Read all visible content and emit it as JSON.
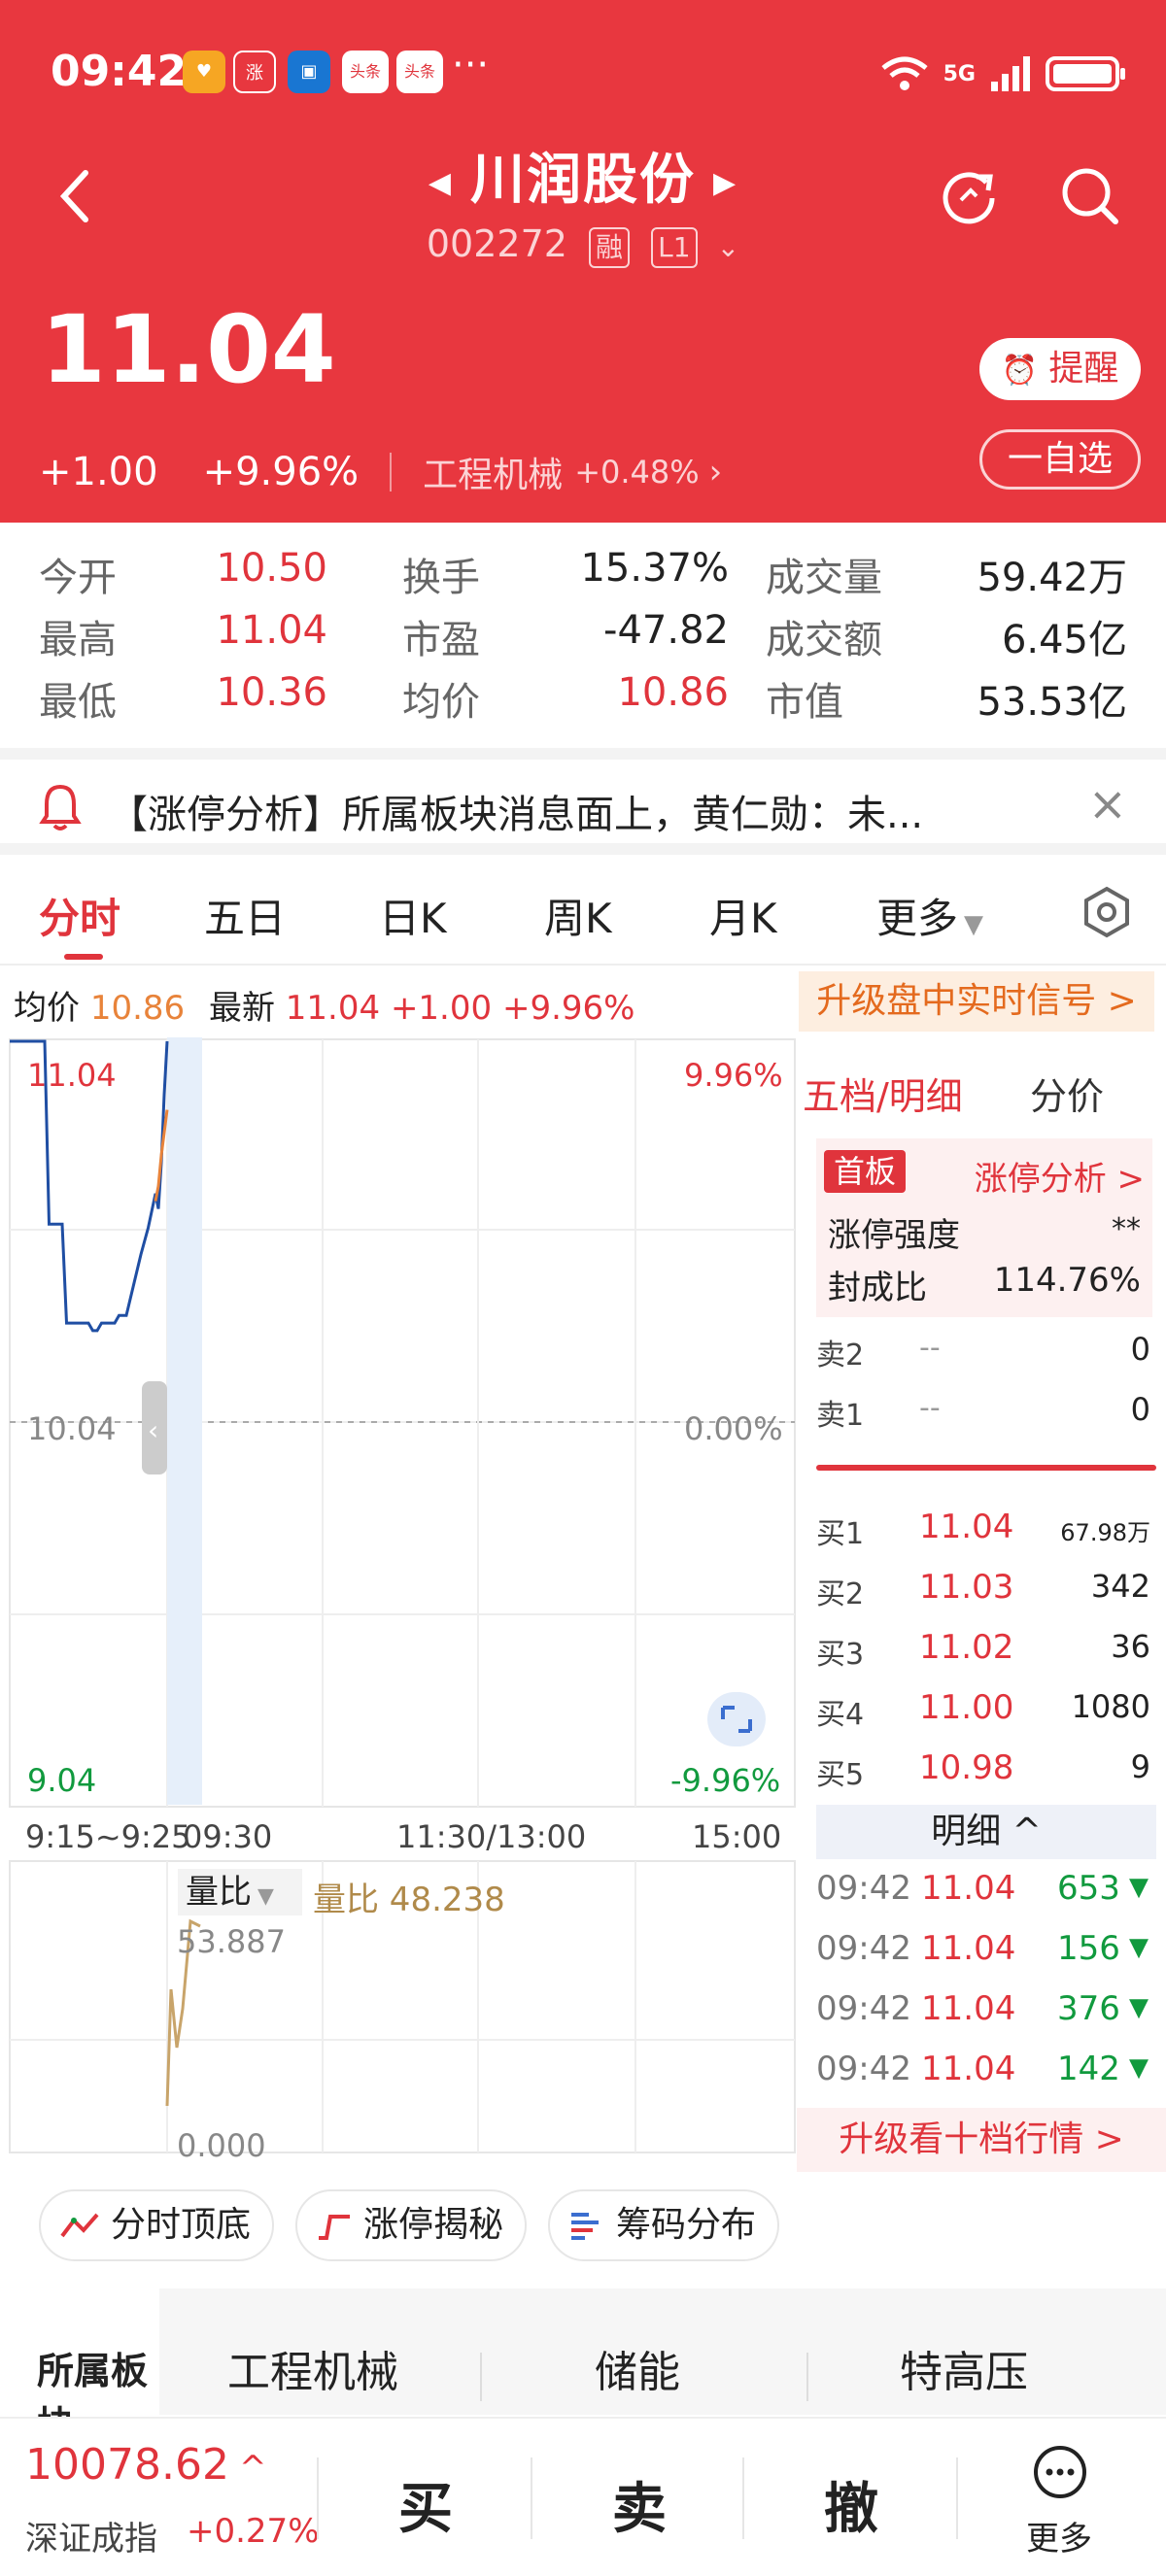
{
  "status_bar": {
    "time": "09:42",
    "net": "5G",
    "app_icons": [
      "涨",
      "",
      "头条",
      "头条"
    ],
    "more": "···"
  },
  "stock": {
    "name": "川润股份",
    "code": "002272",
    "tag_margin": "融",
    "tag_level": "L1",
    "price": "11.04",
    "change": "+1.00",
    "change_pct": "+9.96%",
    "sector": "工程机械",
    "sector_pct": "+0.48%",
    "alert_label": "提醒",
    "watch_label": "一自选"
  },
  "stats": [
    {
      "label": "今开",
      "value": "10.50",
      "color": "red"
    },
    {
      "label": "换手",
      "value": "15.37%",
      "color": "dark"
    },
    {
      "label": "成交量",
      "value": "59.42万",
      "color": "dark"
    },
    {
      "label": "最高",
      "value": "11.04",
      "color": "red"
    },
    {
      "label": "市盈",
      "value": "-47.82",
      "color": "dark"
    },
    {
      "label": "成交额",
      "value": "6.45亿",
      "color": "dark"
    },
    {
      "label": "最低",
      "value": "10.36",
      "color": "red"
    },
    {
      "label": "均价",
      "value": "10.86",
      "color": "red"
    },
    {
      "label": "市值",
      "value": "53.53亿",
      "color": "dark"
    }
  ],
  "notice": {
    "text": "【涨停分析】所属板块消息面上，黄仁勋：未...",
    "close": "×"
  },
  "tabs": [
    "分时",
    "五日",
    "日K",
    "周K",
    "月K",
    "更多"
  ],
  "chart_info": {
    "avg_label": "均价",
    "avg_value": "10.86",
    "latest_label": "最新",
    "latest_value": "11.04",
    "change": "+1.00",
    "pct": "+9.96%",
    "upgrade": "升级盘中实时信号 >"
  },
  "chart_axes": {
    "top_left": "11.04",
    "top_right": "9.96%",
    "mid_left": "10.04",
    "mid_right": "0.00%",
    "bottom_left": "9.04",
    "bottom_right": "-9.96%",
    "t1": "9:15~9:25",
    "t2": "09:30",
    "t3": "11:30/13:00",
    "t4": "15:00"
  },
  "chart_data": {
    "type": "line",
    "title": "",
    "ylim": [
      9.04,
      11.04
    ],
    "series": [
      {
        "name": "",
        "x": [
          0,
          3,
          6,
          9,
          12,
          15,
          18,
          21,
          24,
          27,
          30,
          33,
          36,
          39,
          42,
          45,
          48,
          51,
          54,
          57,
          60,
          63,
          66,
          69,
          72,
          75,
          80,
          85,
          90,
          95,
          100,
          102,
          104,
          106,
          108
        ],
        "y": [
          11.04,
          11.04,
          11.04,
          11.04,
          11.04,
          11.04,
          11.04,
          11.04,
          11.04,
          10.56,
          10.56,
          10.56,
          10.56,
          10.3,
          10.3,
          10.3,
          10.3,
          10.3,
          10.3,
          10.28,
          10.28,
          10.3,
          10.3,
          10.3,
          10.3,
          10.32,
          10.32,
          10.4,
          10.48,
          10.55,
          10.64,
          10.6,
          10.72,
          10.9,
          11.04
        ]
      },
      {
        "name": "",
        "x": [
          100,
          102,
          104,
          106,
          108
        ],
        "y": [
          10.62,
          10.66,
          10.74,
          10.8,
          10.86
        ]
      }
    ]
  },
  "volume_panel": {
    "tag": "量比",
    "value_label": "量比 48.238",
    "max_label": "53.887",
    "min_label": "0.000"
  },
  "order_book": {
    "tabs": [
      "五档/明细",
      "分价"
    ],
    "limit_badge": "首板",
    "limit_link": "涨停分析 >",
    "strength_label": "涨停强度",
    "strength_value": "**",
    "ratio_label": "封成比",
    "ratio_value": "114.76%",
    "asks": [
      {
        "name": "卖2",
        "price": "--",
        "vol": "0"
      },
      {
        "name": "卖1",
        "price": "--",
        "vol": "0"
      }
    ],
    "bids": [
      {
        "name": "买1",
        "price": "11.04",
        "vol": "67.98万"
      },
      {
        "name": "买2",
        "price": "11.03",
        "vol": "342"
      },
      {
        "name": "买3",
        "price": "11.02",
        "vol": "36"
      },
      {
        "name": "买4",
        "price": "11.00",
        "vol": "1080"
      },
      {
        "name": "买5",
        "price": "10.98",
        "vol": "9"
      }
    ],
    "detail_label": "明细 ^",
    "ticks": [
      {
        "time": "09:42",
        "price": "11.04",
        "vol": "653"
      },
      {
        "time": "09:42",
        "price": "11.04",
        "vol": "156"
      },
      {
        "time": "09:42",
        "price": "11.04",
        "vol": "376"
      },
      {
        "time": "09:42",
        "price": "11.04",
        "vol": "142"
      }
    ],
    "upgrade": "升级看十档行情 >"
  },
  "chips": [
    "分时顶底",
    "涨停揭秘",
    "筹码分布"
  ],
  "sector_strip": {
    "label": "所属板块",
    "items": [
      {
        "name": "工程机械"
      },
      {
        "name": "储能"
      },
      {
        "name": "特高压"
      }
    ]
  },
  "bottom_bar": {
    "index_value": "10078.62",
    "index_name": "深证成指",
    "index_pct": "+0.27%",
    "buy": "买",
    "sell": "卖",
    "cancel": "撤",
    "more": "更多"
  },
  "colors": {
    "header": "#e8373f",
    "up": "#e0343c",
    "down": "#119a3e",
    "price_line": "#1f4ea3",
    "avg_line": "#e8833a"
  }
}
